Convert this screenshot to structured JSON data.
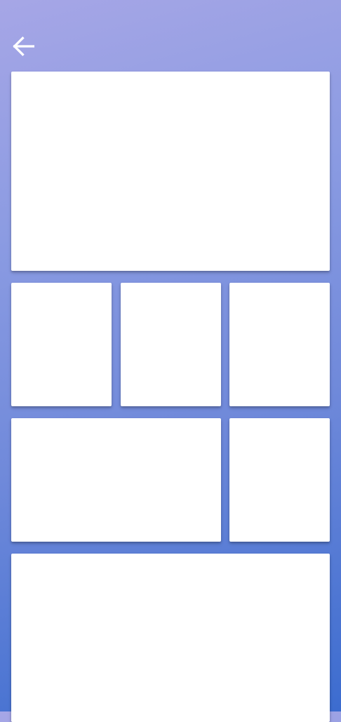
{
  "header": {
    "back_icon": "arrow-left-icon",
    "icon_color": "#ffffff"
  },
  "theme": {
    "gradient_top": "#a6a6e6",
    "gradient_bottom": "#3c6ccf",
    "card_color": "#ffffff"
  },
  "cards": [
    {
      "id": "hero"
    },
    {
      "id": "r2-1"
    },
    {
      "id": "r2-2"
    },
    {
      "id": "r2-3"
    },
    {
      "id": "r3-wide"
    },
    {
      "id": "r3-small"
    },
    {
      "id": "bottom"
    }
  ]
}
